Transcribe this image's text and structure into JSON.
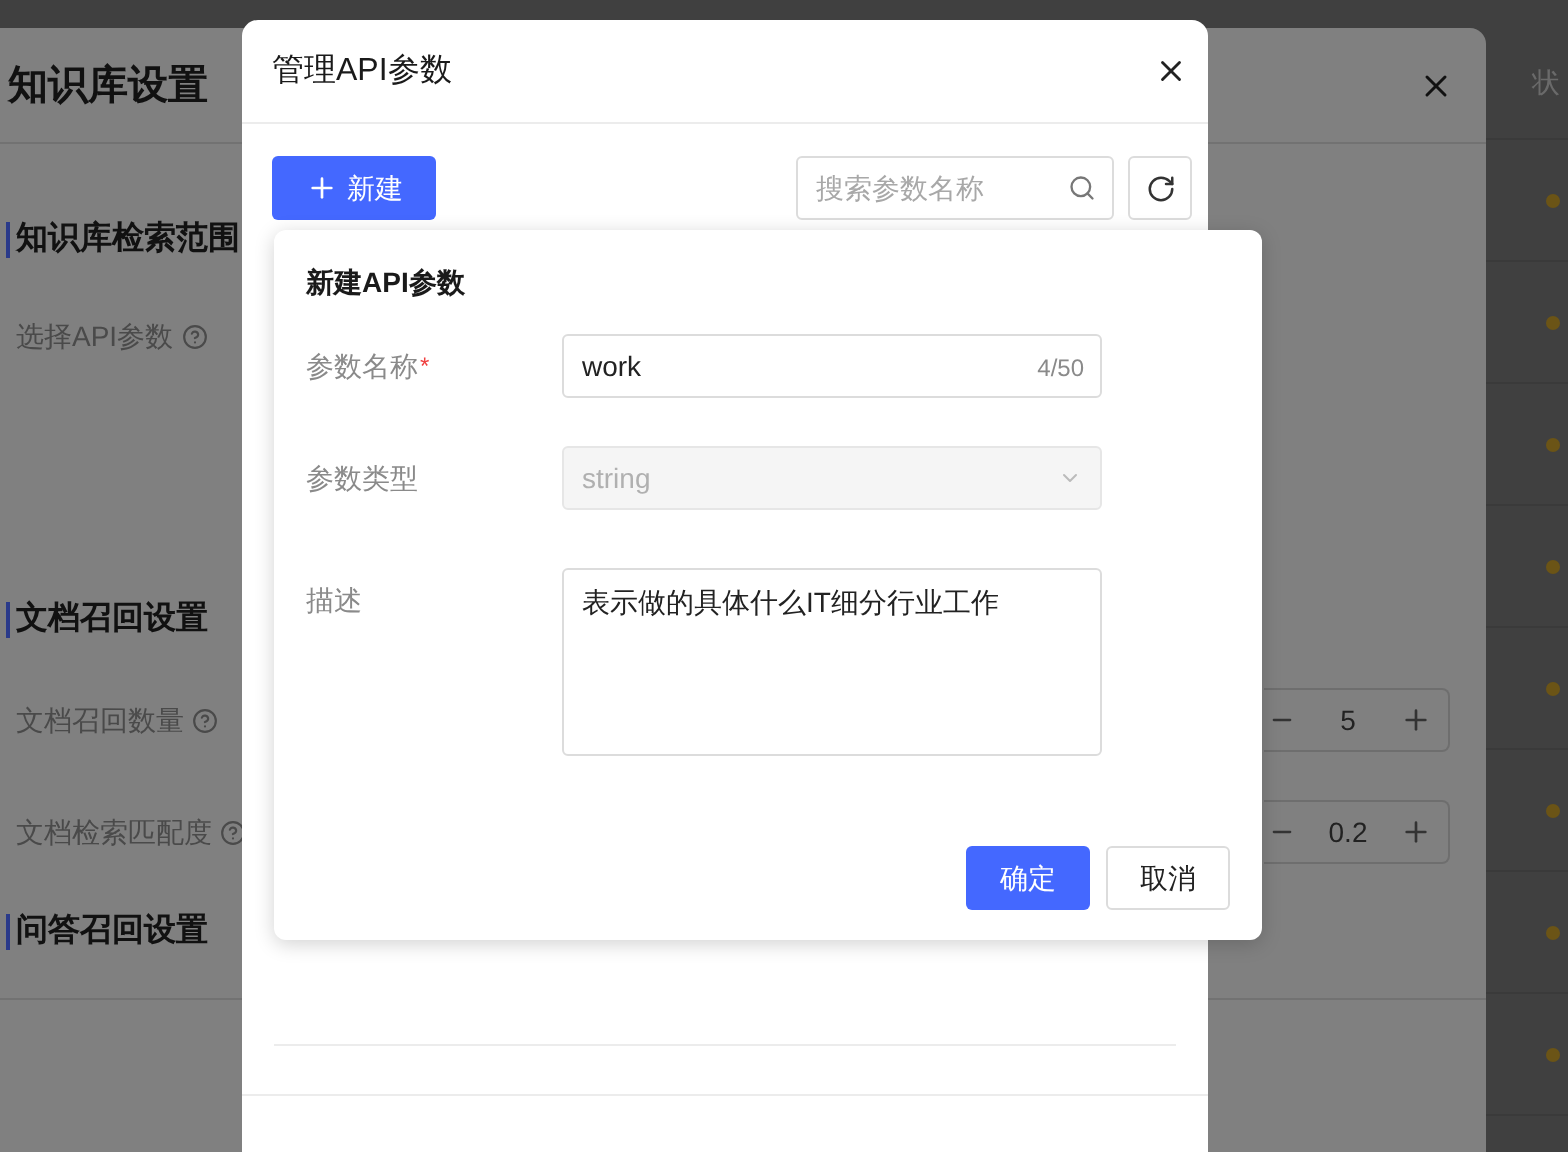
{
  "background": {
    "column_header": "状",
    "rows": [
      {
        "color": "#6b5416"
      },
      {
        "color": "#6b5416"
      },
      {
        "color": "#6b5416"
      },
      {
        "color": "#6b5416"
      },
      {
        "color": "#6b5416"
      },
      {
        "color": "#6b5416"
      },
      {
        "color": "#6b5416"
      },
      {
        "color": "#6b5416"
      }
    ]
  },
  "drawer": {
    "title": "知识库设置",
    "items": [
      {
        "kind": "heading",
        "text": "知识库检索范围"
      },
      {
        "kind": "field",
        "label": "选择API参数"
      },
      {
        "kind": "heading",
        "text": "文档召回设置"
      },
      {
        "kind": "stepper",
        "label": "文档召回数量",
        "value": "5"
      },
      {
        "kind": "stepper",
        "label": "文档检索匹配度",
        "value": "0.2"
      },
      {
        "kind": "heading",
        "text": "问答召回设置"
      }
    ]
  },
  "modal": {
    "title": "管理API参数",
    "new_button": "新建",
    "search": {
      "placeholder": "搜索参数名称"
    }
  },
  "popover": {
    "title": "新建API参数",
    "name": {
      "label": "参数名称",
      "required_mark": "*",
      "value": "work",
      "counter": "4/50"
    },
    "type": {
      "label": "参数类型",
      "value": "string",
      "disabled": true
    },
    "description": {
      "label": "描述",
      "value": "表示做的具体什么IT细分行业工作"
    },
    "buttons": [
      {
        "label": "确定",
        "kind": "primary"
      },
      {
        "label": "取消",
        "kind": "default"
      }
    ]
  }
}
